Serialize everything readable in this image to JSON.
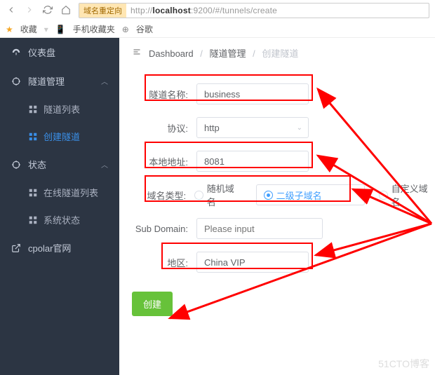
{
  "browser": {
    "redirect_badge": "域名重定向",
    "url_pre": "http://",
    "url_host": "localhost",
    "url_port": ":9200",
    "url_path": "/#/tunnels/create"
  },
  "bookmarks": {
    "fav": "收藏",
    "mobile": "手机收藏夹",
    "google": "谷歌"
  },
  "sidebar": {
    "dashboard": "仪表盘",
    "tunnel_mgmt": "隧道管理",
    "tunnel_list": "隧道列表",
    "create_tunnel": "创建隧道",
    "status": "状态",
    "online_list": "在线隧道列表",
    "sys_status": "系统状态",
    "cpolar": "cpolar官网"
  },
  "crumbs": {
    "dashboard": "Dashboard",
    "mgmt": "隧道管理",
    "create": "创建隧道"
  },
  "form": {
    "name_lbl": "隧道名称:",
    "name_val": "business",
    "proto_lbl": "协议:",
    "proto_val": "http",
    "local_lbl": "本地地址:",
    "local_val": "8081",
    "domain_lbl": "域名类型:",
    "domain_opts": {
      "random": "随机域名",
      "sub": "二级子域名",
      "custom": "自定义域名"
    },
    "sub_lbl": "Sub Domain:",
    "sub_ph": "Please input",
    "region_lbl": "地区:",
    "region_val": "China VIP",
    "submit": "创建"
  },
  "watermark": "51CTO博客"
}
